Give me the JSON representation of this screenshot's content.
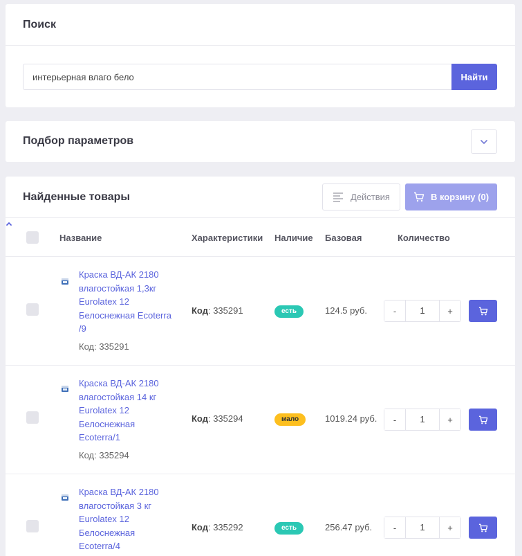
{
  "search": {
    "title": "Поиск",
    "query": "интерьерная влаго бело",
    "button_label": "Найти"
  },
  "filter": {
    "title": "Подбор параметров",
    "toggle_icon": "chevron-down-icon"
  },
  "results": {
    "title": "Найденные товары",
    "actions_label": "Действия",
    "cart_label": "В корзину (0)",
    "columns": {
      "name": "Название",
      "characteristics": "Характеристики",
      "availability": "Наличие",
      "price": "Базовая",
      "quantity": "Количество"
    },
    "sort_icon": "chevron-up-icon",
    "items": [
      {
        "name": "Краска ВД-АК 2180 влагостойкая 1,3кг Eurolatex 12 Белоснежная Ecoterra /9",
        "code_line": "Код: 335291",
        "char_label": "Код",
        "char_value": ": 335291",
        "stock": "есть",
        "stock_color": "#2bc8b4",
        "price": "124.5 руб.",
        "qty": "1",
        "minus": "-",
        "plus": "+"
      },
      {
        "name": "Краска ВД-АК 2180 влагостойкая 14 кг Eurolatex 12 Белоснежная Ecoterra/1",
        "code_line": "Код: 335294",
        "char_label": "Код",
        "char_value": ": 335294",
        "stock": "мало",
        "stock_color": "#fdbf1f",
        "price": "1019.24 руб.",
        "qty": "1",
        "minus": "-",
        "plus": "+"
      },
      {
        "name": "Краска ВД-АК 2180 влагостойкая 3 кг Eurolatex 12 Белоснежная Ecoterra/4",
        "code_line": "",
        "char_label": "Код",
        "char_value": ": 335292",
        "stock": "есть",
        "stock_color": "#2bc8b4",
        "price": "256.47 руб.",
        "qty": "1",
        "minus": "-",
        "plus": "+"
      }
    ]
  },
  "colors": {
    "accent": "#5b64dd",
    "accent_light": "#9da2ec",
    "background": "#eeeef3"
  }
}
